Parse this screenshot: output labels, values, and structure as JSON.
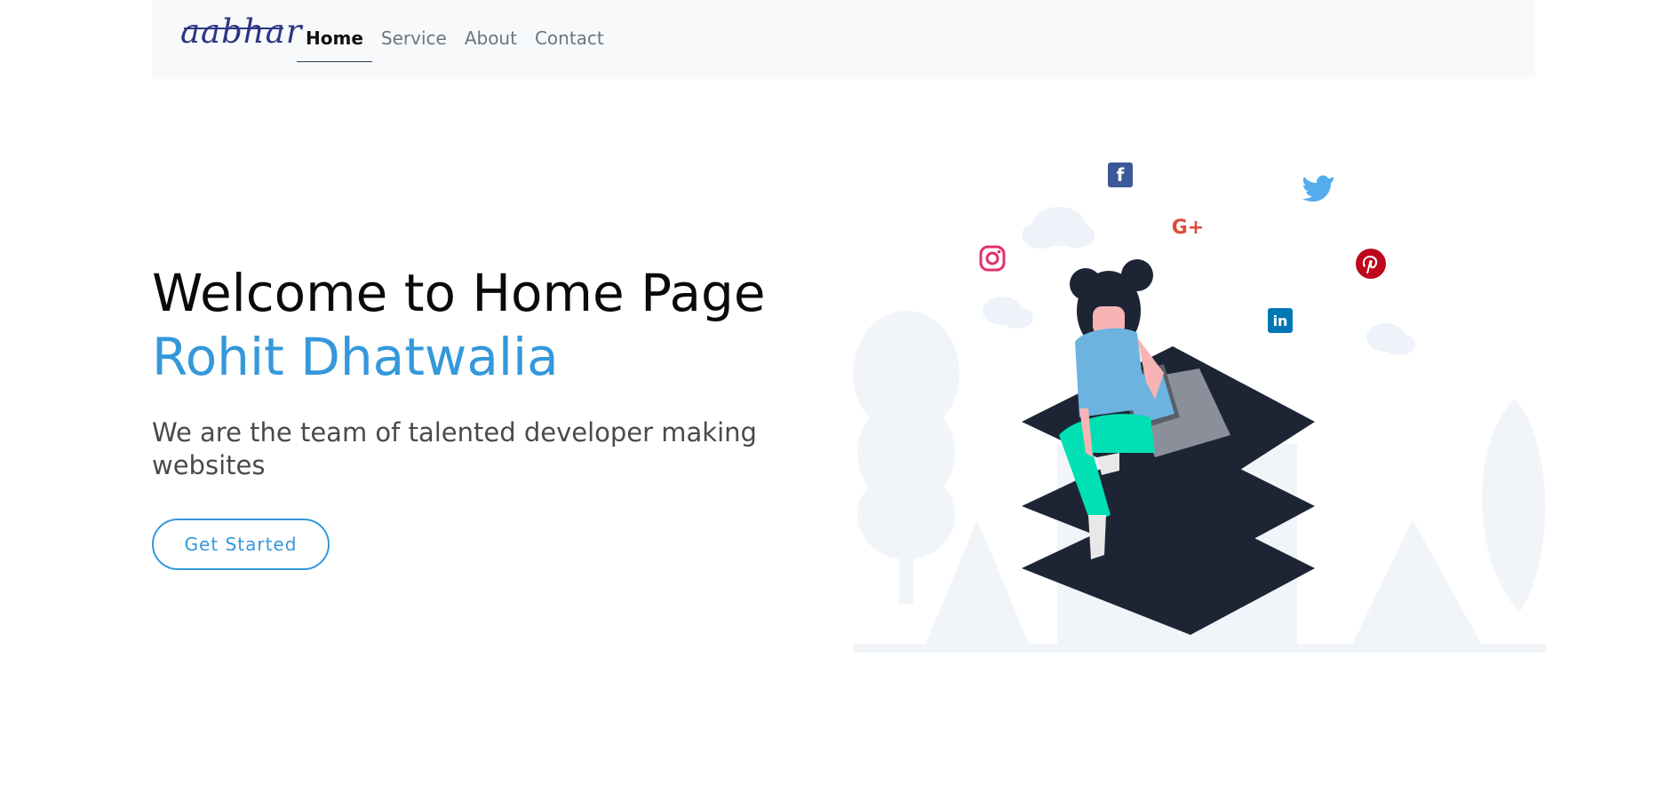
{
  "brand": {
    "logo_text": "aabhar"
  },
  "nav": {
    "items": [
      {
        "label": "Home",
        "active": true
      },
      {
        "label": "Service",
        "active": false
      },
      {
        "label": "About",
        "active": false
      },
      {
        "label": "Contact",
        "active": false
      }
    ]
  },
  "hero": {
    "heading": "Welcome to Home Page",
    "name": "Rohit Dhatwalia",
    "subtitle": "We are the team of talented developer making websites",
    "cta_label": "Get Started"
  },
  "illustration": {
    "social_icons": [
      "facebook-icon",
      "twitter-icon",
      "google-plus-icon",
      "instagram-icon",
      "pinterest-icon",
      "linkedin-icon"
    ],
    "social_glyphs": {
      "facebook": "f",
      "google_plus": "G+",
      "linkedin": "in"
    }
  },
  "colors": {
    "accent": "#3498db",
    "logo": "#2d3583",
    "navbar_bg": "#f8f9fa",
    "platform": "#1d2535",
    "shirt": "#6cb3e0",
    "pants": "#00e0b4",
    "facebook": "#3b5998",
    "twitter": "#55acee",
    "google_plus": "#dd4b39",
    "instagram": "#e1306c",
    "pinterest": "#bd081c",
    "linkedin": "#0077b5"
  }
}
